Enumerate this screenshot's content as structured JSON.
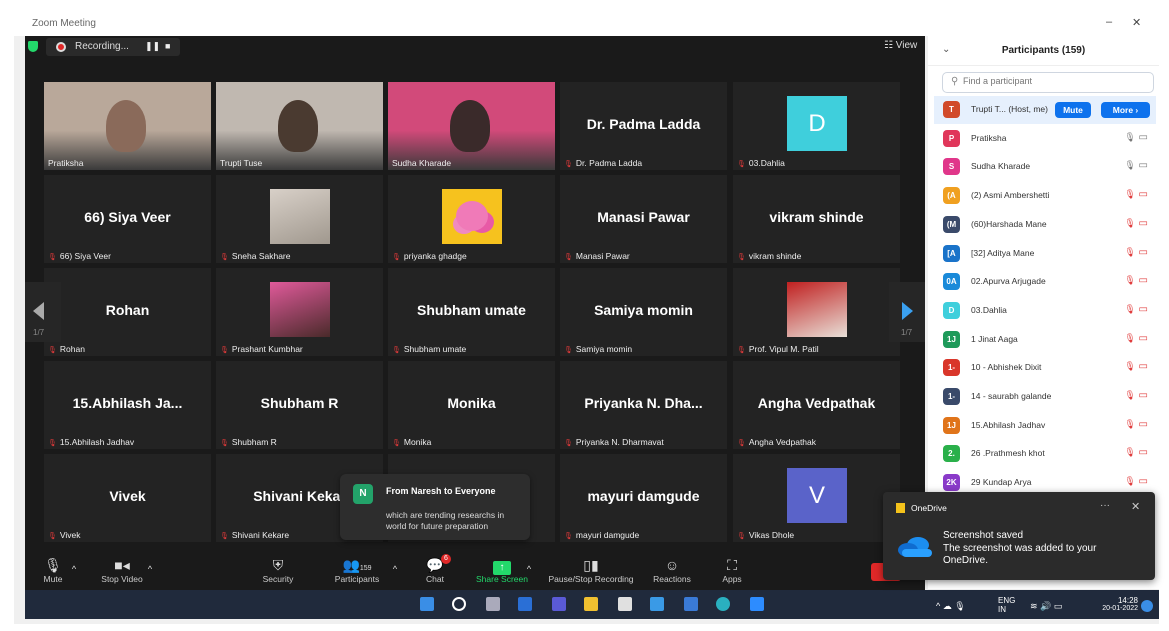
{
  "window": {
    "title": "Zoom Meeting"
  },
  "recording": {
    "label": "Recording...",
    "pause": "❚❚",
    "stop": "■"
  },
  "view_label": "View",
  "tiles": [
    {
      "name": "Pratiksha",
      "display": "",
      "type": "video"
    },
    {
      "name": "Trupti Tuse",
      "display": "",
      "type": "video"
    },
    {
      "name": "Sudha Kharade",
      "display": "",
      "type": "video",
      "active": true
    },
    {
      "name": "Dr. Padma Ladda",
      "display": "Dr. Padma Ladda",
      "type": "text"
    },
    {
      "name": "03.Dahlia",
      "display": "D",
      "type": "letter",
      "color": "#3fcfdc"
    },
    {
      "name": "66) Siya Veer",
      "display": "66) Siya Veer",
      "type": "text"
    },
    {
      "name": "Sneha Sakhare",
      "display": "",
      "type": "photo"
    },
    {
      "name": "priyanka ghadge",
      "display": "",
      "type": "flower"
    },
    {
      "name": "Manasi Pawar",
      "display": "Manasi Pawar",
      "type": "text"
    },
    {
      "name": "vikram shinde",
      "display": "vikram shinde",
      "type": "text"
    },
    {
      "name": "Rohan",
      "display": "Rohan",
      "type": "text"
    },
    {
      "name": "Prashant Kumbhar",
      "display": "",
      "type": "photo"
    },
    {
      "name": "Shubham umate",
      "display": "Shubham umate",
      "type": "text"
    },
    {
      "name": "Samiya momin",
      "display": "Samiya momin",
      "type": "text"
    },
    {
      "name": "Prof. Vipul M. Patil",
      "display": "",
      "type": "photo"
    },
    {
      "name": "15.Abhilash Jadhav",
      "display": "15.Abhilash  Ja...",
      "type": "text"
    },
    {
      "name": "Shubham R",
      "display": "Shubham R",
      "type": "text"
    },
    {
      "name": "Monika",
      "display": "Monika",
      "type": "text"
    },
    {
      "name": "Priyanka N. Dharmavat",
      "display": "Priyanka N. Dha...",
      "type": "text"
    },
    {
      "name": "Angha Vedpathak",
      "display": "Angha Vedpathak",
      "type": "text"
    },
    {
      "name": "Vivek",
      "display": "Vivek",
      "type": "text"
    },
    {
      "name": "Shivani Kekare",
      "display": "Shivani Kekar",
      "type": "text"
    },
    {
      "name": "",
      "display": "",
      "type": "text"
    },
    {
      "name": "mayuri damgude",
      "display": "mayuri damgude",
      "type": "text"
    },
    {
      "name": "Vikas Dhole",
      "display": "V",
      "type": "letter",
      "color": "#5a63c9"
    }
  ],
  "page_indicator": {
    "left": "1/7",
    "right": "1/7"
  },
  "chat_toast": {
    "avatar": "N",
    "from": "From Naresh to Everyone",
    "message": "which are trending researchs in world for future preparation"
  },
  "toolbar": {
    "mute": "Mute",
    "stop_video": "Stop Video",
    "security": "Security",
    "participants": "Participants",
    "participants_count": "159",
    "chat": "Chat",
    "chat_badge": "6",
    "share_screen": "Share Screen",
    "pause_recording": "Pause/Stop Recording",
    "reactions": "Reactions",
    "apps": "Apps"
  },
  "panel": {
    "title": "Participants (159)",
    "search_placeholder": "Find a participant",
    "host_mute": "Mute",
    "host_more": "More ›",
    "participants": [
      {
        "initials": "T",
        "name": "Trupti T... (Host, me)",
        "color": "#d14a2a",
        "host": true
      },
      {
        "initials": "P",
        "name": "Pratiksha",
        "color": "#e0365a",
        "audio": "on"
      },
      {
        "initials": "S",
        "name": "Sudha Kharade",
        "color": "#e0368a",
        "audio": "on"
      },
      {
        "initials": "(A",
        "name": "(2) Asmi Ambershetti",
        "color": "#f0a020",
        "audio": "muted"
      },
      {
        "initials": "(M",
        "name": "(60)Harshada Mane",
        "color": "#3a4a6a",
        "audio": "muted"
      },
      {
        "initials": "[A",
        "name": "[32] Aditya Mane",
        "color": "#1a73c9",
        "audio": "muted"
      },
      {
        "initials": "0A",
        "name": "02.Apurva Arjugade",
        "color": "#1a8ad9",
        "audio": "muted"
      },
      {
        "initials": "D",
        "name": "03.Dahlia",
        "color": "#3fcfdc",
        "audio": "muted"
      },
      {
        "initials": "1J",
        "name": "1 Jinat Aaga",
        "color": "#1e9a5a",
        "audio": "muted"
      },
      {
        "initials": "1-",
        "name": "10 - Abhishek Dixit",
        "color": "#d9362a",
        "audio": "muted"
      },
      {
        "initials": "1-",
        "name": "14 - saurabh galande",
        "color": "#3a4a6a",
        "audio": "muted"
      },
      {
        "initials": "1J",
        "name": "15.Abhilash  Jadhav",
        "color": "#e0741a",
        "audio": "muted"
      },
      {
        "initials": "2.",
        "name": "26 .Prathmesh khot",
        "color": "#2ab04a",
        "audio": "muted"
      },
      {
        "initials": "2K",
        "name": "29 Kundap Arya",
        "color": "#8a3ac9",
        "audio": "muted"
      }
    ]
  },
  "onedrive": {
    "app": "OneDrive",
    "dots": "···",
    "close": "✕",
    "title": "Screenshot saved",
    "message": "The screenshot was added to your OneDrive."
  },
  "taskbar": {
    "lang": "ENG",
    "region": "IN",
    "time": "14:28",
    "date": "20-01-2022"
  }
}
